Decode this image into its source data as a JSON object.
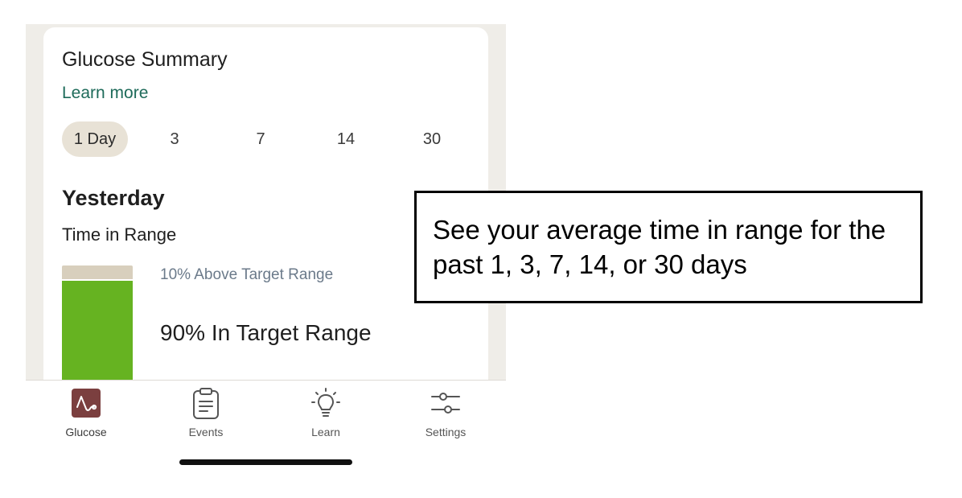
{
  "summary": {
    "title": "Glucose Summary",
    "learn_more": "Learn more",
    "ranges": [
      {
        "label": "1 Day",
        "selected": true
      },
      {
        "label": "3",
        "selected": false
      },
      {
        "label": "7",
        "selected": false
      },
      {
        "label": "14",
        "selected": false
      },
      {
        "label": "30",
        "selected": false
      }
    ],
    "day_heading": "Yesterday",
    "section_label": "Time in Range",
    "above_target_percent": 10,
    "in_target_percent": 90,
    "above_label": "10% Above Target Range",
    "in_label": "90% In Target Range",
    "colors": {
      "in_range": "#66b321",
      "above_range": "#d8cfbd",
      "accent": "#1e6b5a"
    }
  },
  "tabbar": {
    "items": [
      {
        "label": "Glucose",
        "icon": "glucose-wave-icon",
        "active": true
      },
      {
        "label": "Events",
        "icon": "clipboard-icon",
        "active": false
      },
      {
        "label": "Learn",
        "icon": "lightbulb-icon",
        "active": false
      },
      {
        "label": "Settings",
        "icon": "sliders-icon",
        "active": false
      }
    ],
    "active_color": "#7b3f3f"
  },
  "callout": {
    "text": "See your average time in range for the past 1, 3, 7, 14, or 30 days"
  }
}
